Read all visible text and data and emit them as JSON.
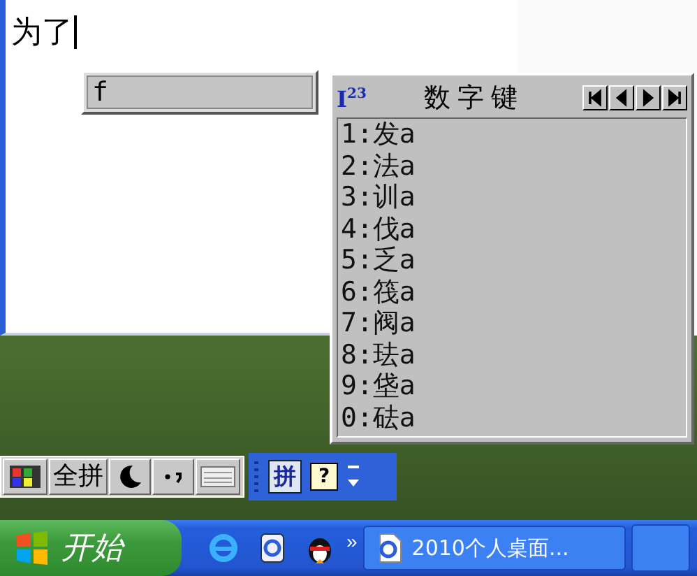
{
  "document": {
    "text": "为了"
  },
  "composition": {
    "text": "f"
  },
  "candidates": {
    "logo": "I$^{23}$",
    "title": "数字键",
    "items": [
      "1:发a",
      "2:法a",
      "3:训a",
      "4:伐a",
      "5:乏a",
      "6:筏a",
      "7:阀a",
      "8:珐a",
      "9:垡a",
      "0:砝a"
    ]
  },
  "ime_toolbar": {
    "mode": "全拼"
  },
  "language_bar": {
    "ime_char": "拼",
    "help": "?"
  },
  "taskbar": {
    "start": "开始",
    "more": "»",
    "tasks": [
      {
        "label": "2010个人桌面...",
        "selected": false
      }
    ]
  }
}
